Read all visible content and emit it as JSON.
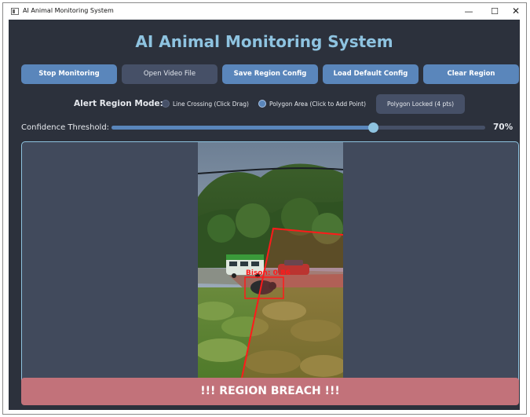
{
  "window": {
    "title": "AI Animal Monitoring System",
    "controls": {
      "minimize": "—",
      "maximize": "☐",
      "close": "✕"
    }
  },
  "header": {
    "title": "AI Animal Monitoring System"
  },
  "toolbar": {
    "buttons": [
      {
        "label": "Stop Monitoring"
      },
      {
        "label": "Open Video File"
      },
      {
        "label": "Save Region Config"
      },
      {
        "label": "Load Default Config"
      },
      {
        "label": "Clear Region"
      }
    ]
  },
  "region_mode": {
    "label": "Alert Region Mode:",
    "options": [
      {
        "label": "Line Crossing (Click  Drag)",
        "selected": false
      },
      {
        "label": "Polygon Area (Click to Add Point)",
        "selected": true
      }
    ],
    "polygon_button": "Polygon Locked (4 pts)"
  },
  "confidence": {
    "label": "Confidence Threshold:",
    "value": 0.7,
    "value_text": "70%"
  },
  "video": {
    "detection_label": "Bison: 0.86"
  },
  "alert": {
    "text": "!!! REGION BREACH !!!"
  },
  "colors": {
    "background": "#2c313c",
    "panel": "#414a5c",
    "accent": "#5a86bb",
    "heading": "#8ec3e0",
    "breach": "#c2727a",
    "detection": "#ff1a1a"
  }
}
